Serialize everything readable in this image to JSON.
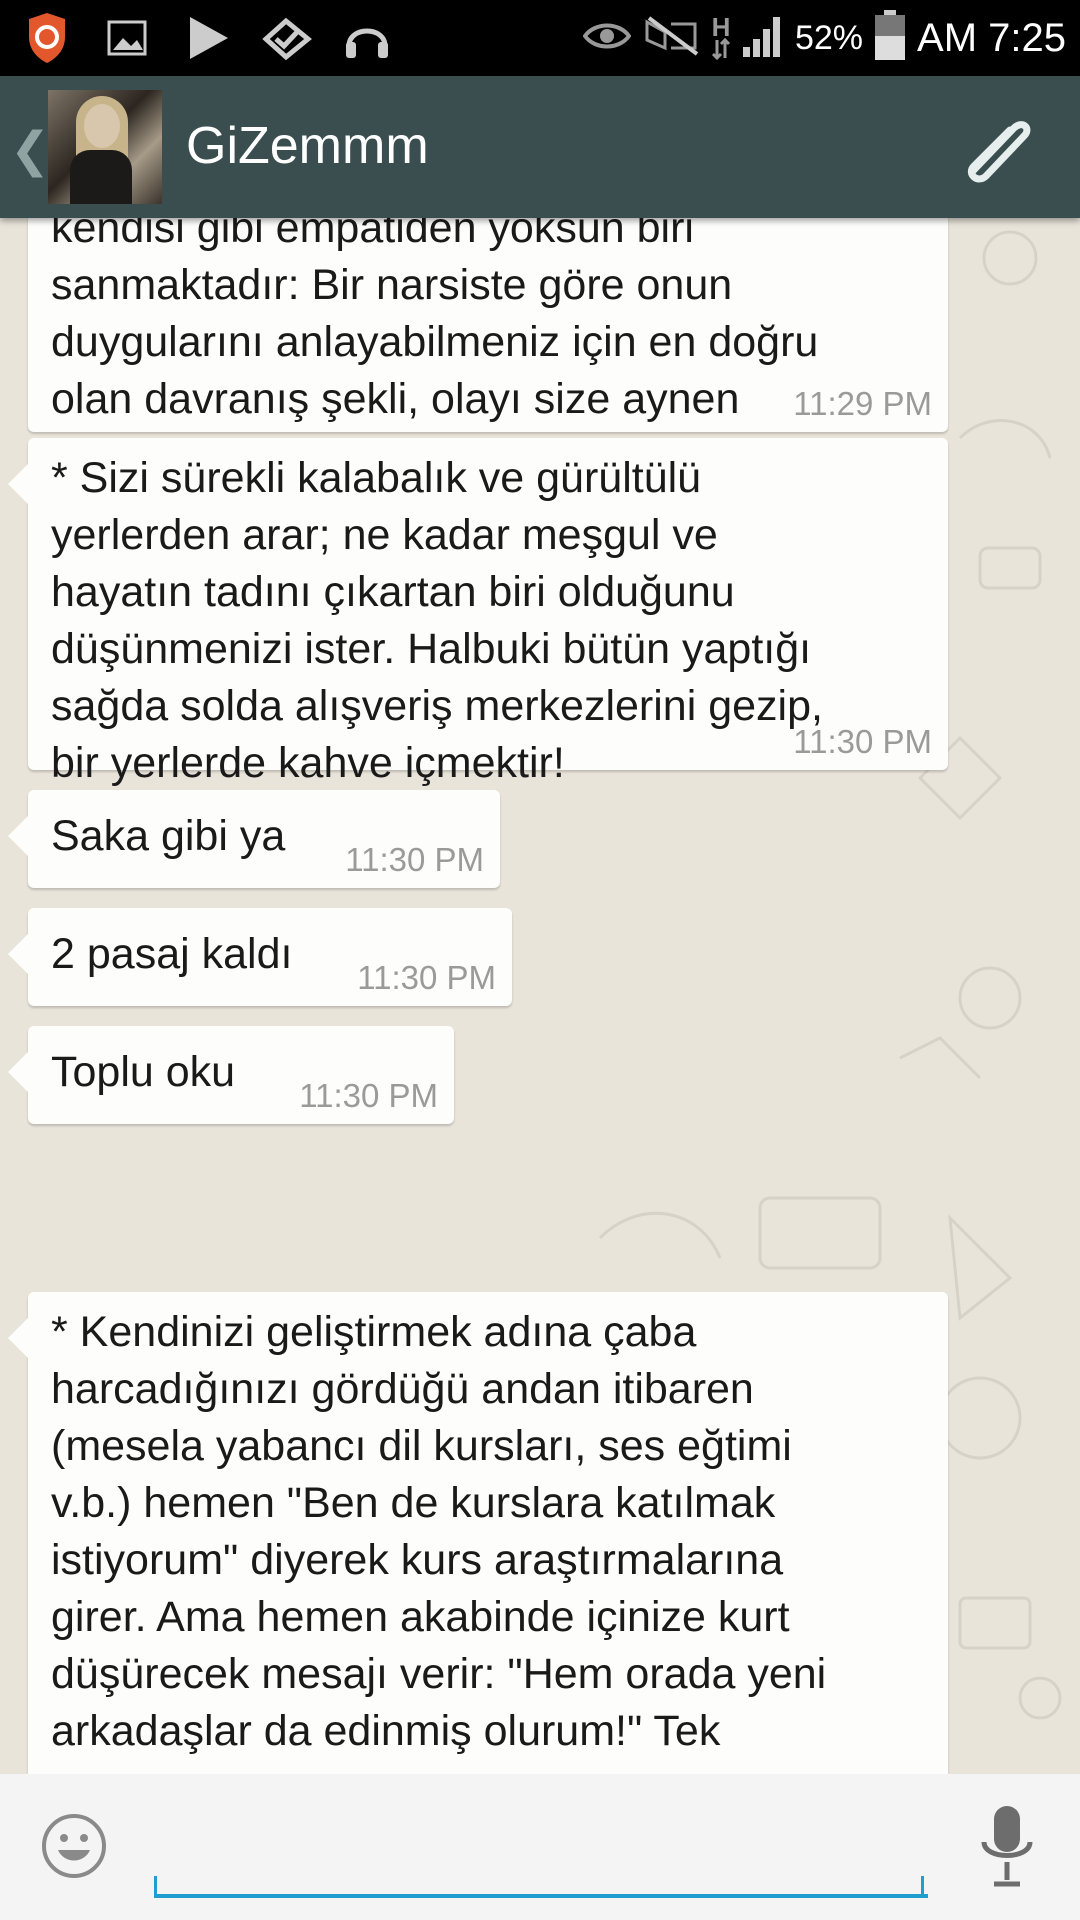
{
  "status_bar": {
    "battery_percent": "52%",
    "time": "AM 7:25",
    "network_type": "H",
    "icons": [
      "shield-icon",
      "image-icon",
      "play-icon",
      "check-icon",
      "headphones-icon",
      "eye-icon",
      "signal-icon",
      "mute-icon",
      "network-icon",
      "cell-signal-icon",
      "battery-icon"
    ]
  },
  "header": {
    "contact_name": "GiZemmm",
    "back_symbol": "❮"
  },
  "messages": [
    {
      "text": "kendisi gibi empatiden yoksun biri\nsanmaktadır: Bir narsiste göre onun\nduygularını anlayabilmeniz için en doğru\nolan davranış şekli, olayı size aynen\ntecrübe ettirmeleridir!",
      "time": "11:29 PM"
    },
    {
      "text": "* Sizi sürekli kalabalık ve gürültülü\nyerlerden arar; ne kadar meşgul ve\nhayatın tadını çıkartan biri olduğunu\ndüşünmenizi ister. Halbuki bütün yaptığı\nsağda solda alışveriş merkezlerini gezip,\nbir yerlerde kahve içmektir!",
      "time": "11:30 PM"
    },
    {
      "text": "Saka gibi ya",
      "time": "11:30 PM"
    },
    {
      "text": "2 pasaj kaldı",
      "time": "11:30 PM"
    },
    {
      "text": "Toplu oku",
      "time": "11:30 PM"
    },
    {
      "text": "* Kendinizi geliştirmek adına çaba\nharcadığınızı gördüğü andan itibaren\n(mesela yabancı dil kursları, ses eğtimi\nv.b.) hemen \"Ben de kurslara katılmak\nistiyorum\" diyerek kurs araştırmalarına\ngirer. Ama hemen akabinde içinize kurt\ndüşürecek mesajı verir: \"Hem orada yeni\narkadaşlar da edinmiş olurum!\" Tek",
      "time": ""
    }
  ],
  "composer": {
    "placeholder": ""
  },
  "colors": {
    "header_bg": "#3a4e4f",
    "chat_bg": "#e8e4da",
    "bubble_bg": "#fdfdfb",
    "input_underline": "#1e9fcf"
  }
}
